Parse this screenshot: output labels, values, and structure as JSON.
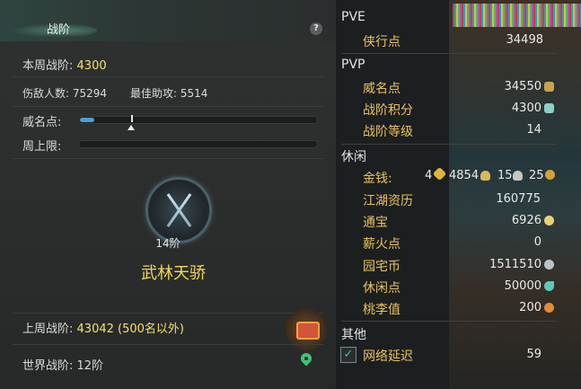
{
  "left_panel": {
    "title": "战阶",
    "help": "?",
    "weekly": {
      "label": "本周战阶:",
      "value": "4300"
    },
    "kills": {
      "label": "伤敌人数:",
      "value": "75294"
    },
    "assists": {
      "label": "最佳助攻:",
      "value": "5514"
    },
    "fame": {
      "label": "威名点:",
      "progress": 0.06
    },
    "weekly_cap": {
      "label": "周上限:",
      "progress": 0.0
    },
    "rank_tier": "14阶",
    "rank_name": "武林天骄",
    "last_week": {
      "label": "上周战阶:",
      "value": "43042 (500名以外)"
    },
    "world": {
      "label": "世界战阶:",
      "value": "12阶"
    }
  },
  "right_panel": {
    "pve": {
      "header": "PVE",
      "items": [
        {
          "label": "侠行点",
          "value": "34498"
        }
      ]
    },
    "pvp": {
      "header": "PVP",
      "items": [
        {
          "label": "威名点",
          "value": "34550"
        },
        {
          "label": "战阶积分",
          "value": "4300"
        },
        {
          "label": "战阶等级",
          "value": "14"
        }
      ]
    },
    "leisure": {
      "header": "休闲",
      "money": {
        "label": "金钱:",
        "gold": "4",
        "silver": "4854",
        "copper": "15",
        "coins": "25"
      },
      "items": [
        {
          "label": "江湖资历",
          "value": "160775"
        },
        {
          "label": "通宝",
          "value": "6926"
        },
        {
          "label": "薪火点",
          "value": "0"
        },
        {
          "label": "园宅币",
          "value": "1511510"
        },
        {
          "label": "休闲点",
          "value": "50000"
        },
        {
          "label": "桃李值",
          "value": "200"
        }
      ]
    },
    "other": {
      "header": "其他",
      "latency": {
        "label": "网络延迟",
        "value": "59"
      }
    }
  },
  "colors": {
    "accent_yellow": "#f3e36a",
    "key_gold": "#e9c35a",
    "bar_blue": "#4aa0d8",
    "title_gold": "#f0d955"
  }
}
